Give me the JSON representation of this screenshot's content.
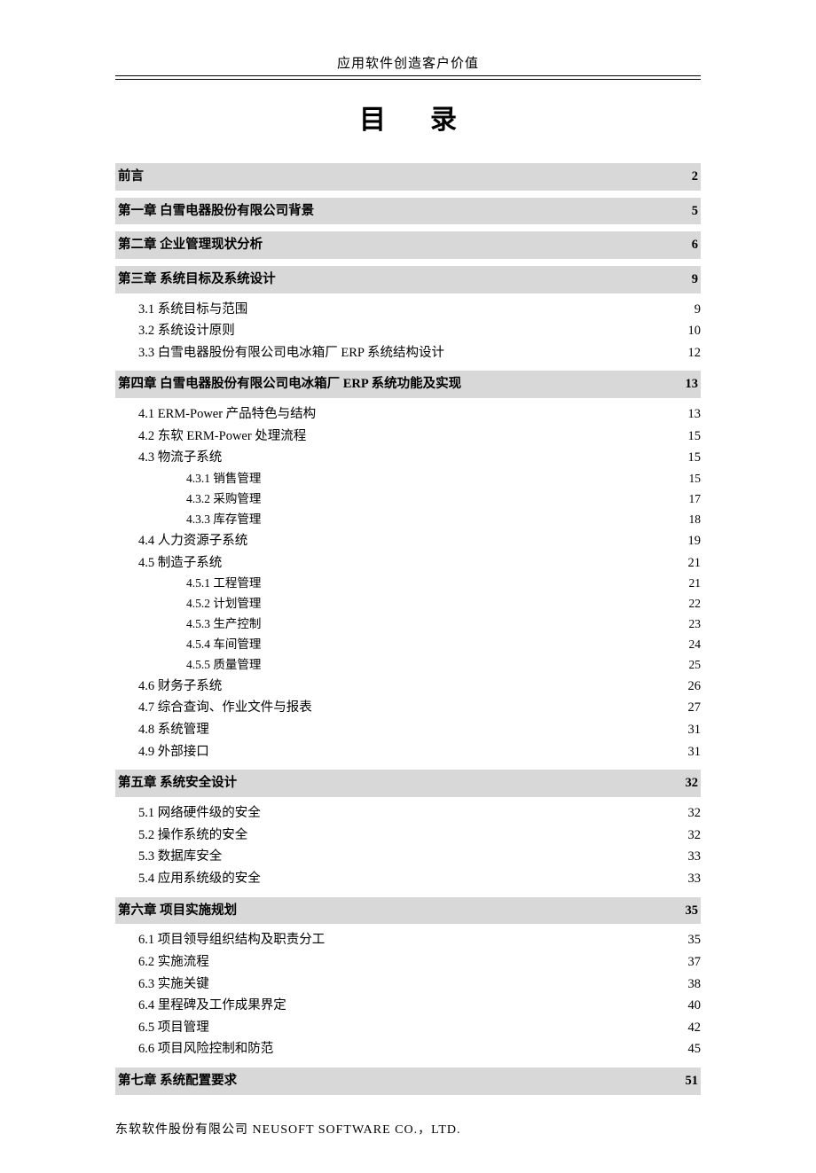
{
  "header": {
    "title": "应用软件创造客户价值"
  },
  "toc_title": "目录",
  "toc": [
    {
      "label": "前言",
      "page": "2",
      "level": 1
    },
    {
      "label": "第一章  白雪电器股份有限公司背景",
      "page": "5",
      "level": 1
    },
    {
      "label": "第二章  企业管理现状分析",
      "page": "6",
      "level": 1
    },
    {
      "label": "第三章  系统目标及系统设计",
      "page": "9",
      "level": 1
    },
    {
      "label": "3.1 系统目标与范围",
      "page": "9",
      "level": 2
    },
    {
      "label": "3.2 系统设计原则",
      "page": "10",
      "level": 2
    },
    {
      "label": "3.3 白雪电器股份有限公司电冰箱厂 ERP 系统结构设计",
      "page": "12",
      "level": 2
    },
    {
      "label": "第四章  白雪电器股份有限公司电冰箱厂 ERP 系统功能及实现",
      "page": "13",
      "level": 1
    },
    {
      "label": "4.1 ERM-Power 产品特色与结构",
      "page": "13",
      "level": 2
    },
    {
      "label": "4.2 东软 ERM-Power 处理流程",
      "page": "15",
      "level": 2
    },
    {
      "label": "4.3 物流子系统",
      "page": "15",
      "level": 2
    },
    {
      "label": "4.3.1 销售管理",
      "page": "15",
      "level": 3
    },
    {
      "label": "4.3.2 采购管理",
      "page": "17",
      "level": 3
    },
    {
      "label": "4.3.3 库存管理",
      "page": "18",
      "level": 3
    },
    {
      "label": "4.4 人力资源子系统",
      "page": "19",
      "level": 2
    },
    {
      "label": "4.5 制造子系统",
      "page": "21",
      "level": 2
    },
    {
      "label": "4.5.1 工程管理",
      "page": "21",
      "level": 3
    },
    {
      "label": "4.5.2 计划管理",
      "page": "22",
      "level": 3
    },
    {
      "label": "4.5.3 生产控制",
      "page": "23",
      "level": 3
    },
    {
      "label": "4.5.4 车间管理",
      "page": "24",
      "level": 3
    },
    {
      "label": "4.5.5 质量管理",
      "page": "25",
      "level": 3
    },
    {
      "label": "4.6 财务子系统",
      "page": "26",
      "level": 2
    },
    {
      "label": "4.7 综合查询、作业文件与报表",
      "page": "27",
      "level": 2
    },
    {
      "label": "4.8 系统管理",
      "page": "31",
      "level": 2
    },
    {
      "label": "4.9 外部接口",
      "page": "31",
      "level": 2
    },
    {
      "label": "第五章  系统安全设计",
      "page": "32",
      "level": 1
    },
    {
      "label": "5.1 网络硬件级的安全",
      "page": "32",
      "level": 2
    },
    {
      "label": "5.2 操作系统的安全",
      "page": "32",
      "level": 2
    },
    {
      "label": "5.3 数据库安全",
      "page": "33",
      "level": 2
    },
    {
      "label": "5.4 应用系统级的安全",
      "page": "33",
      "level": 2
    },
    {
      "label": "第六章  项目实施规划",
      "page": "35",
      "level": 1
    },
    {
      "label": "6.1 项目领导组织结构及职责分工",
      "page": "35",
      "level": 2
    },
    {
      "label": "6.2 实施流程",
      "page": "37",
      "level": 2
    },
    {
      "label": "6.3 实施关键",
      "page": "38",
      "level": 2
    },
    {
      "label": "6.4 里程碑及工作成果界定",
      "page": "40",
      "level": 2
    },
    {
      "label": "6.5 项目管理",
      "page": "42",
      "level": 2
    },
    {
      "label": "6.6 项目风险控制和防范",
      "page": "45",
      "level": 2
    },
    {
      "label": "第七章  系统配置要求",
      "page": "51",
      "level": 1
    }
  ],
  "footer": {
    "company": "东软软件股份有限公司  NEUSOFT  SOFTWARE  CO.，LTD."
  }
}
